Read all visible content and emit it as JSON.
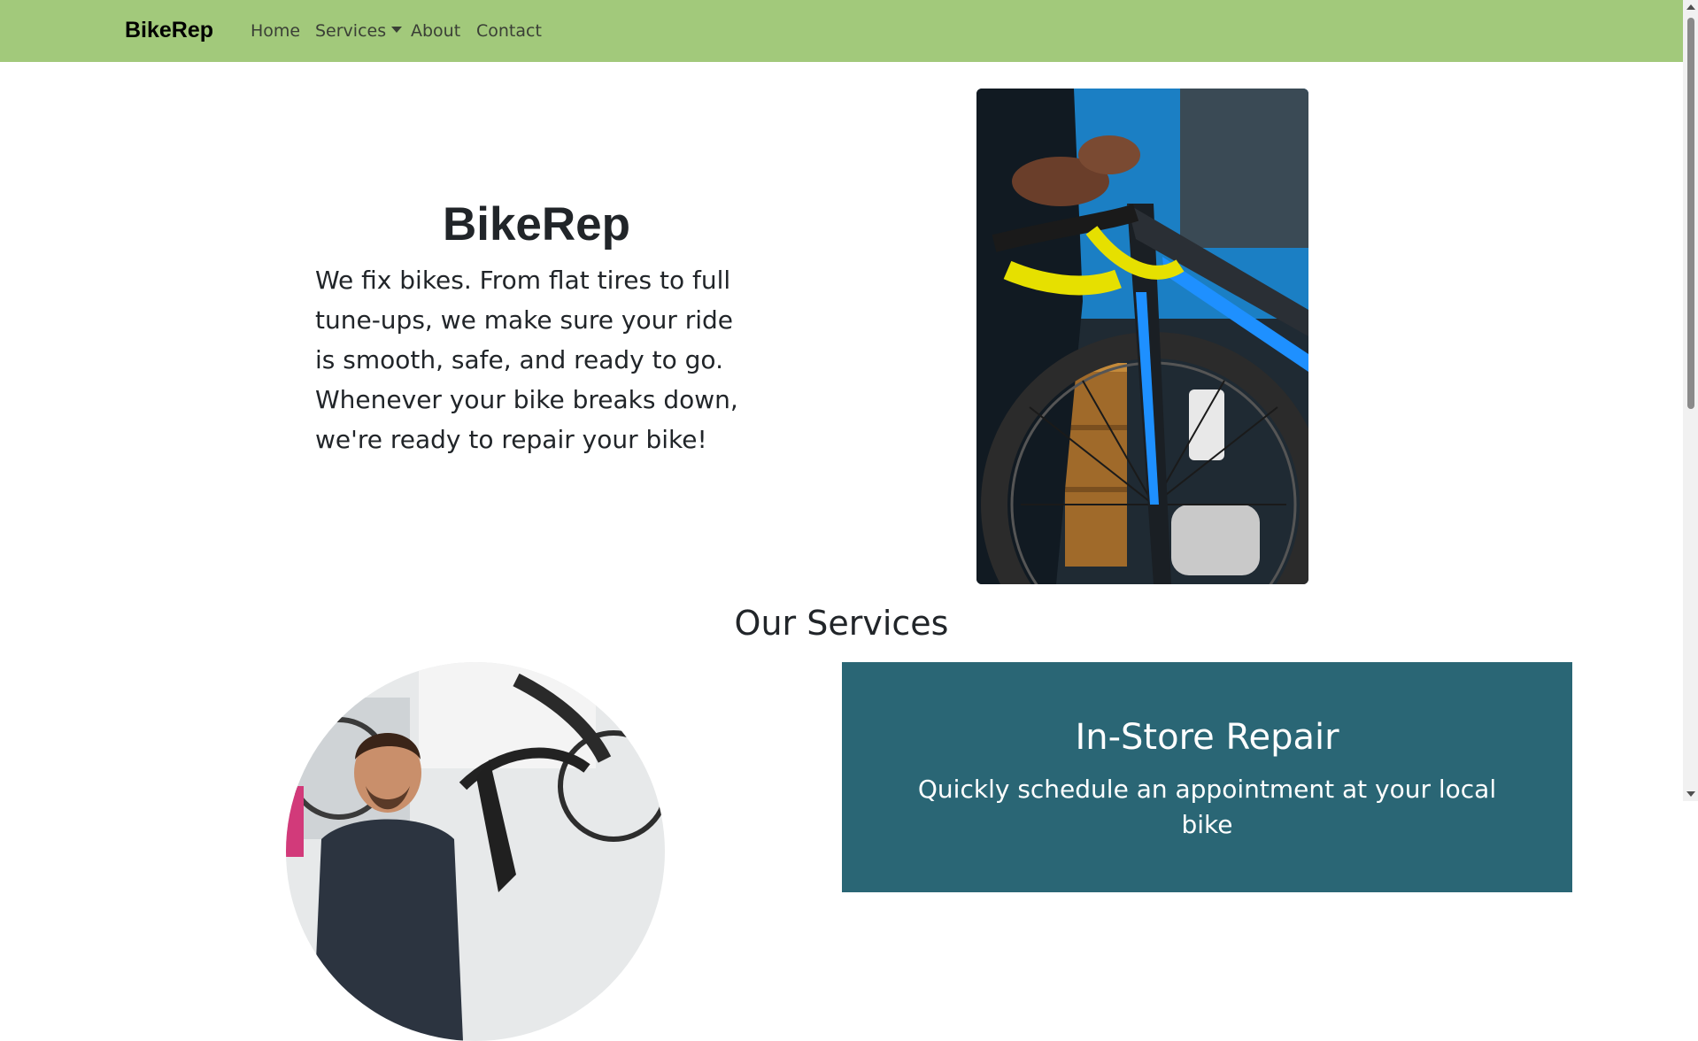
{
  "navbar": {
    "brand": "BikeRep",
    "links": [
      {
        "label": "Home"
      },
      {
        "label": "Services",
        "dropdown": true
      },
      {
        "label": "About"
      },
      {
        "label": "Contact"
      }
    ],
    "background": "#a2c97b"
  },
  "hero": {
    "title": "BikeRep",
    "text": "We fix bikes. From flat tires to full tune-ups, we make sure your ride is smooth, safe, and ready to go. Whenever your bike breaks down, we're ready to repair your bike!"
  },
  "services": {
    "heading": "Our Services",
    "card": {
      "title": "In-Store Repair",
      "text": "Quickly schedule an appointment at your local bike",
      "background": "#2a6675"
    }
  },
  "icons": {
    "caret": "chevron-down-icon"
  }
}
